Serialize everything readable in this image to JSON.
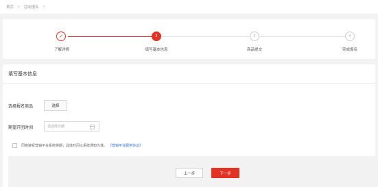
{
  "breadcrumb": {
    "home": "首页",
    "separator": ">",
    "current": "活动报名",
    "trailing": ">"
  },
  "steps": [
    {
      "label": "了解详情",
      "marker": "✓",
      "state": "done"
    },
    {
      "label": "填写基本信息",
      "marker": "2",
      "state": "active"
    },
    {
      "label": "商品提交",
      "marker": "3",
      "state": "pending"
    },
    {
      "label": "完成报名",
      "marker": "4",
      "state": "pending"
    }
  ],
  "form": {
    "section_title": "填写基本信息",
    "select_product_label": "选择报名商品",
    "select_button": "选择",
    "date_label": "期望开团时间",
    "date_placeholder": "请选择日期",
    "agree_text": "同意接受营销平台系统排期，具体时间以系统通知为准。",
    "agree_link": "《营销平台服务协议》"
  },
  "footer": {
    "prev_button": "上一步",
    "next_button": "下一步"
  },
  "colors": {
    "accent": "#e03324",
    "link": "#2f6fd6"
  }
}
